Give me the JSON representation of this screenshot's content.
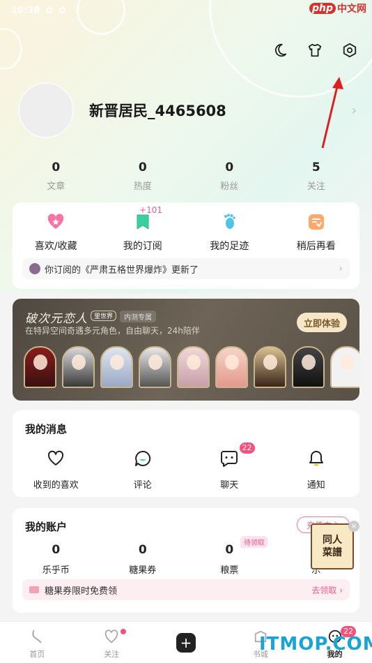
{
  "status_bar": {
    "time": "10:38"
  },
  "watermark_top": {
    "brand": "php",
    "text": "中文网"
  },
  "profile": {
    "username": "新晋居民_4465608"
  },
  "stats": [
    {
      "value": "0",
      "label": "文章"
    },
    {
      "value": "0",
      "label": "热度"
    },
    {
      "value": "0",
      "label": "粉丝"
    },
    {
      "value": "5",
      "label": "关注"
    }
  ],
  "quick_actions": {
    "items": [
      {
        "label": "喜欢/收藏",
        "icon": "heart-star-icon"
      },
      {
        "label": "我的订阅",
        "icon": "bookmark-icon"
      },
      {
        "label": "我的足迹",
        "icon": "footprint-icon"
      },
      {
        "label": "稍后再看",
        "icon": "watch-later-icon"
      }
    ],
    "subscription_badge": "+101",
    "notice": "你订阅的《严肃五格世界爆炸》更新了"
  },
  "banner": {
    "title": "破次元恋人",
    "tag_brand": "里世界",
    "tag_beta": "内测专属",
    "subtitle": "在特异空间奇遇多元角色，自由聊天，24h陪伴",
    "button": "立即体验"
  },
  "messages": {
    "title": "我的消息",
    "items": [
      {
        "label": "收到的喜欢",
        "icon": "heart-outline-icon"
      },
      {
        "label": "评论",
        "icon": "comment-icon"
      },
      {
        "label": "聊天",
        "icon": "chat-icon"
      },
      {
        "label": "通知",
        "icon": "bell-icon"
      }
    ],
    "chat_badge": "22"
  },
  "account": {
    "title": "我的账户",
    "recharge": "充值中心",
    "items": [
      {
        "value": "0",
        "label": "乐乎币"
      },
      {
        "value": "0",
        "label": "糖果券"
      },
      {
        "value": "0",
        "label": "粮票"
      },
      {
        "value": "",
        "label": "乐"
      }
    ],
    "pending_tag": "待领取",
    "coupon_text": "糖果券限时免费领",
    "coupon_action": "去领取 ›"
  },
  "float_promo": {
    "line1": "同人",
    "line2": "菜譜"
  },
  "tabbar": {
    "items": [
      {
        "label": "首页"
      },
      {
        "label": "关注"
      },
      {
        "label": ""
      },
      {
        "label": "书城"
      },
      {
        "label": "我的"
      }
    ],
    "me_badge": "22"
  },
  "watermark_bottom": "ITMOP.COM",
  "colors": {
    "accent_pink": "#f05a8c",
    "badge": "#f4527d",
    "annotation_arrow": "#e02020"
  }
}
